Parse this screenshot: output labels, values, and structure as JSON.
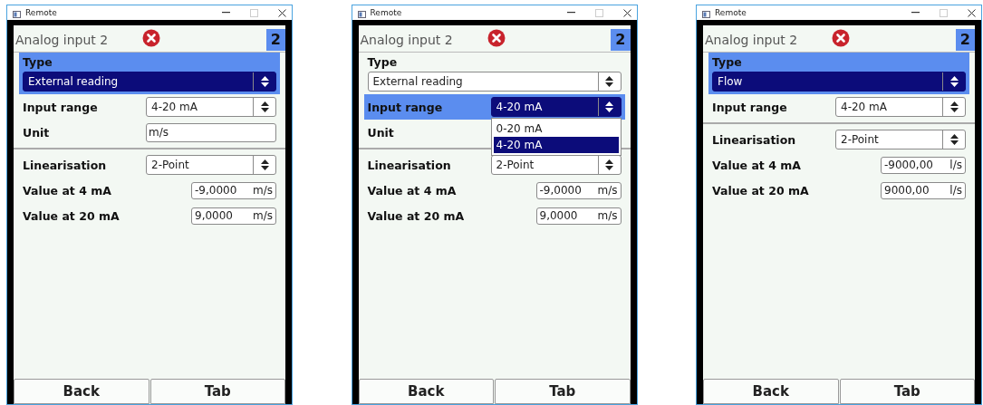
{
  "windows": [
    {
      "title": "Remote",
      "screen": {
        "title": "Analog input 2",
        "page": "2",
        "sections": [
          {
            "rows": [
              {
                "kind": "stacked-select",
                "label": "Type",
                "value": "External reading",
                "selected": true
              },
              {
                "kind": "select",
                "label": "Input range",
                "value": "4-20 mA",
                "selected": false
              },
              {
                "kind": "text",
                "label": "Unit",
                "value": "m/s",
                "selected": false
              }
            ]
          },
          {
            "rows": [
              {
                "kind": "select",
                "label": "Linearisation",
                "value": "2-Point",
                "selected": false
              },
              {
                "kind": "value",
                "label": "Value at 4 mA",
                "value": "-9,0000",
                "unit": "m/s",
                "selected": false
              },
              {
                "kind": "value",
                "label": "Value at 20 mA",
                "value": "9,0000",
                "unit": "m/s",
                "selected": false
              }
            ]
          }
        ],
        "buttons": [
          "Back",
          "Tab"
        ]
      }
    },
    {
      "title": "Remote",
      "screen": {
        "title": "Analog input 2",
        "page": "2",
        "sections": [
          {
            "rows": [
              {
                "kind": "stacked-select",
                "label": "Type",
                "value": "External reading",
                "selected": false
              },
              {
                "kind": "select",
                "label": "Input range",
                "value": "4-20 mA",
                "selected": true,
                "options": [
                  {
                    "label": "0-20 mA",
                    "selected": false
                  },
                  {
                    "label": "4-20 mA",
                    "selected": true
                  }
                ]
              },
              {
                "kind": "label",
                "label": "Unit",
                "selected": false
              }
            ]
          },
          {
            "rows": [
              {
                "kind": "select",
                "label": "Linearisation",
                "value": "2-Point",
                "selected": false
              },
              {
                "kind": "value",
                "label": "Value at 4 mA",
                "value": "-9,0000",
                "unit": "m/s",
                "selected": false
              },
              {
                "kind": "value",
                "label": "Value at 20 mA",
                "value": "9,0000",
                "unit": "m/s",
                "selected": false
              }
            ]
          }
        ],
        "buttons": [
          "Back",
          "Tab"
        ]
      }
    },
    {
      "title": "Remote",
      "screen": {
        "title": "Analog input 2",
        "page": "2",
        "sections": [
          {
            "rows": [
              {
                "kind": "stacked-select",
                "label": "Type",
                "value": "Flow",
                "selected": true
              },
              {
                "kind": "select",
                "label": "Input range",
                "value": "4-20 mA",
                "selected": false
              }
            ]
          },
          {
            "rows": [
              {
                "kind": "select",
                "label": "Linearisation",
                "value": "2-Point",
                "selected": false
              },
              {
                "kind": "value",
                "label": "Value at 4 mA",
                "value": "-9000,00",
                "unit": "l/s",
                "selected": false
              },
              {
                "kind": "value",
                "label": "Value at 20 mA",
                "value": "9000,00",
                "unit": "l/s",
                "selected": false
              }
            ]
          }
        ],
        "buttons": [
          "Back",
          "Tab"
        ]
      }
    }
  ]
}
